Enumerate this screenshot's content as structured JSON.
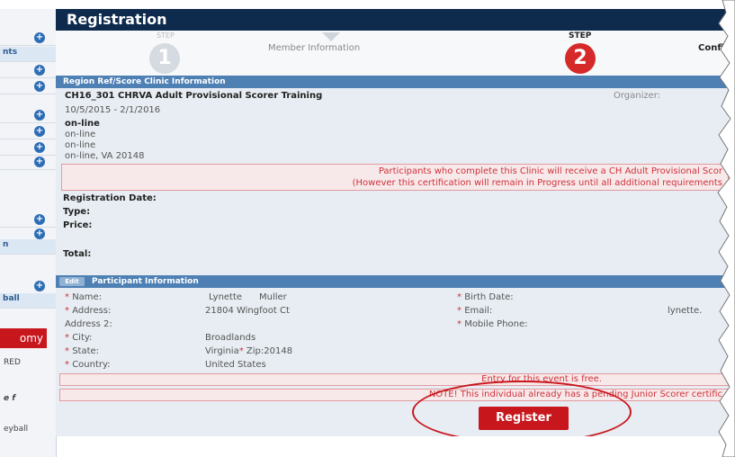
{
  "sidebar": {
    "rows": [
      {
        "text": "",
        "has_btn": true
      },
      {
        "text": "nts",
        "has_btn": false
      },
      {
        "text": "",
        "has_btn": true
      },
      {
        "text": "",
        "has_btn": true
      },
      {
        "text": "",
        "has_btn": true
      },
      {
        "text": "",
        "has_btn": true
      },
      {
        "text": "",
        "has_btn": true
      },
      {
        "text": "",
        "has_btn": true
      },
      {
        "text": "",
        "has_btn": true
      },
      {
        "text": "",
        "has_btn": true
      },
      {
        "text": "n",
        "has_btn": false
      },
      {
        "text": "",
        "has_btn": true
      },
      {
        "text": "ball",
        "has_btn": false
      }
    ],
    "red_button": "omy",
    "small_1": "RED",
    "small_2": "e f",
    "small_3": "eyball"
  },
  "header": {
    "title": "Registration"
  },
  "steps": {
    "step1_label": "STEP",
    "step1_number": "1",
    "step1_name": "Member Information",
    "step2_label": "STEP",
    "step2_number": "2",
    "step3_name": "Confi"
  },
  "clinic": {
    "section_title": "Region Ref/Score Clinic Information",
    "name": "CH16_301 CHRVA Adult Provisional Scorer Training",
    "organizer_label": "Organizer:",
    "dates": "10/5/2015 - 2/1/2016",
    "location_name": "on-line",
    "address1": "on-line",
    "address2": "on-line",
    "city_state_zip": "on-line, VA  20148",
    "notice_line1": "Participants who complete this Clinic will receive a CH Adult Provisional Scor",
    "notice_line2": "(However this certification will remain in Progress until all additional requirements",
    "registration_date_label": "Registration Date:",
    "type_label": "Type:",
    "price_label": "Price:",
    "total_label": "Total:"
  },
  "participant": {
    "section_title": "Participant Information",
    "edit_label": "Edit",
    "name_label": "Name:",
    "name_first": "Lynette",
    "name_last": "Muller",
    "address_label": "Address:",
    "address_value": "21804 Wingfoot Ct",
    "address2_label": "Address 2:",
    "city_label": "City:",
    "city_value": "Broadlands",
    "state_label": "State:",
    "state_value": "Virginia",
    "zip_label": "Zip:",
    "zip_value": "20148",
    "country_label": "Country:",
    "country_value": "United States",
    "birth_label": "Birth Date:",
    "email_label": "Email:",
    "email_value": "lynette.",
    "mobile_label": "Mobile Phone:"
  },
  "notices": {
    "free": "Entry for this event is free.",
    "pending": "NOTE! This individual already has a pending Junior Scorer certific"
  },
  "actions": {
    "register": "Register"
  },
  "colors": {
    "header_bg": "#0e2a4c",
    "section_bar": "#4e80b4",
    "step2_circle": "#d62a2a",
    "register_btn": "#c8161d"
  }
}
